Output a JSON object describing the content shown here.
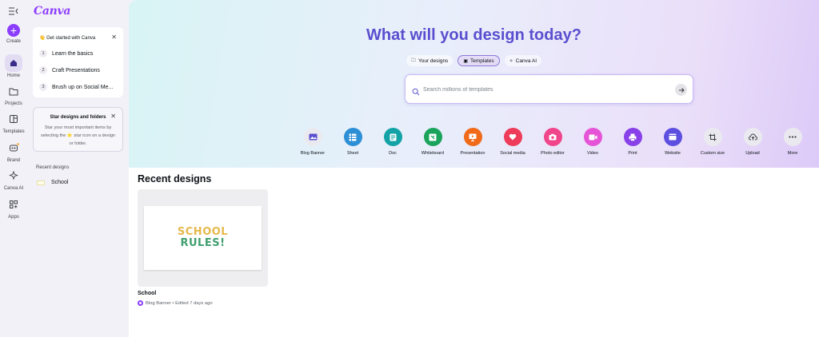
{
  "rail": {
    "create": "Create",
    "items": [
      {
        "label": "Home",
        "icon": "home-icon"
      },
      {
        "label": "Projects",
        "icon": "folder-icon"
      },
      {
        "label": "Templates",
        "icon": "templates-icon"
      },
      {
        "label": "Brand",
        "icon": "brand-icon"
      },
      {
        "label": "Canva AI",
        "icon": "sparkle-icon"
      },
      {
        "label": "Apps",
        "icon": "apps-icon"
      }
    ]
  },
  "sidebar": {
    "logo": "Canva",
    "get_started": {
      "title": "Get started with Canva",
      "items": [
        {
          "num": "1",
          "label": "Learn the basics"
        },
        {
          "num": "2",
          "label": "Craft Presentations"
        },
        {
          "num": "3",
          "label": "Brush up on Social Me..."
        }
      ]
    },
    "star": {
      "title": "Star designs and folders",
      "body": "Star your most important items by selecting the ⭐ star icon on a design or folder."
    },
    "recent_label": "Recent designs",
    "recent_items": [
      {
        "label": "School"
      }
    ]
  },
  "hero": {
    "title": "What will you design today?",
    "chips": [
      {
        "label": "Your designs",
        "icon": "folder-icon"
      },
      {
        "label": "Templates",
        "icon": "templates-icon"
      },
      {
        "label": "Canva AI",
        "icon": "sparkle-icon"
      }
    ],
    "search_placeholder": "Search millions of templates"
  },
  "categories": [
    {
      "label": "Blog Banner",
      "color": "#ebe9f0",
      "icon": "image-icon"
    },
    {
      "label": "Sheet",
      "color": "#2d8fd5",
      "icon": "sheet-icon"
    },
    {
      "label": "Doc",
      "color": "#13a3a6",
      "icon": "doc-icon"
    },
    {
      "label": "Whiteboard",
      "color": "#1aa35b",
      "icon": "whiteboard-icon"
    },
    {
      "label": "Presentation",
      "color": "#f06a19",
      "icon": "presentation-icon"
    },
    {
      "label": "Social media",
      "color": "#ee3b5a",
      "icon": "heart-icon"
    },
    {
      "label": "Photo editor",
      "color": "#f0458b",
      "icon": "camera-icon"
    },
    {
      "label": "Video",
      "color": "#e554d6",
      "icon": "video-icon"
    },
    {
      "label": "Print",
      "color": "#8840e8",
      "icon": "print-icon"
    },
    {
      "label": "Website",
      "color": "#5d4fe0",
      "icon": "website-icon"
    },
    {
      "label": "Custom size",
      "color": "#ebe9f0",
      "icon": "crop-icon"
    },
    {
      "label": "Upload",
      "color": "#ebe9f0",
      "icon": "upload-icon"
    },
    {
      "label": "More",
      "color": "#ebe9f0",
      "icon": "more-icon"
    }
  ],
  "recent": {
    "title": "Recent designs",
    "design": {
      "image_line1": "SCHOOL",
      "image_line2": "RULES!",
      "name": "School",
      "meta": "Blog Banner • Edited 7 days ago"
    }
  },
  "colors": {
    "brand": "#8b3dff",
    "hero_title": "#5a4fcf"
  }
}
